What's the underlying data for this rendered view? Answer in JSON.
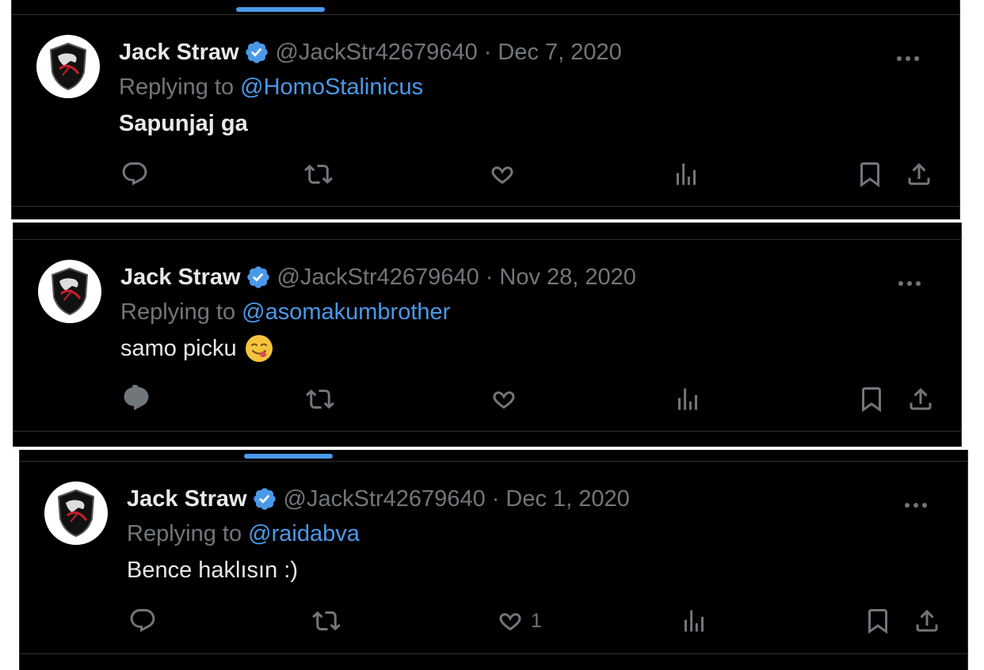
{
  "colors": {
    "background": "#000000",
    "text_primary": "#e7e9ea",
    "text_secondary": "#71767b",
    "accent": "#4a99e9",
    "verified_badge": "#4a99e9",
    "border": "#2f3336"
  },
  "tweets": [
    {
      "display_name": "Jack Straw",
      "handle": "@JackStr42679640",
      "separator": "·",
      "date": "Dec 7, 2020",
      "reply_prefix": "Replying to",
      "reply_to": "@HomoStalinicus",
      "text": "Sapunjaj ga",
      "like_count": "",
      "icons": [
        "reply-icon",
        "retweet-icon",
        "like-icon",
        "views-icon",
        "bookmark-icon",
        "share-icon",
        "more-icon",
        "verified-badge-icon"
      ]
    },
    {
      "display_name": "Jack Straw",
      "handle": "@JackStr42679640",
      "separator": "·",
      "date": "Nov 28, 2020",
      "reply_prefix": "Replying to",
      "reply_to": "@asomakumbrother",
      "text": "samo picku",
      "emoji": "face-savoring-food",
      "like_count": "",
      "icons": [
        "reply-icon",
        "retweet-icon",
        "like-icon",
        "views-icon",
        "bookmark-icon",
        "share-icon",
        "more-icon",
        "verified-badge-icon"
      ]
    },
    {
      "display_name": "Jack Straw",
      "handle": "@JackStr42679640",
      "separator": "·",
      "date": "Dec 1, 2020",
      "reply_prefix": "Replying to",
      "reply_to": "@raidabva",
      "text": "Bence haklısın :)",
      "like_count": "1",
      "icons": [
        "reply-icon",
        "retweet-icon",
        "like-icon",
        "views-icon",
        "bookmark-icon",
        "share-icon",
        "more-icon",
        "verified-badge-icon"
      ]
    }
  ]
}
